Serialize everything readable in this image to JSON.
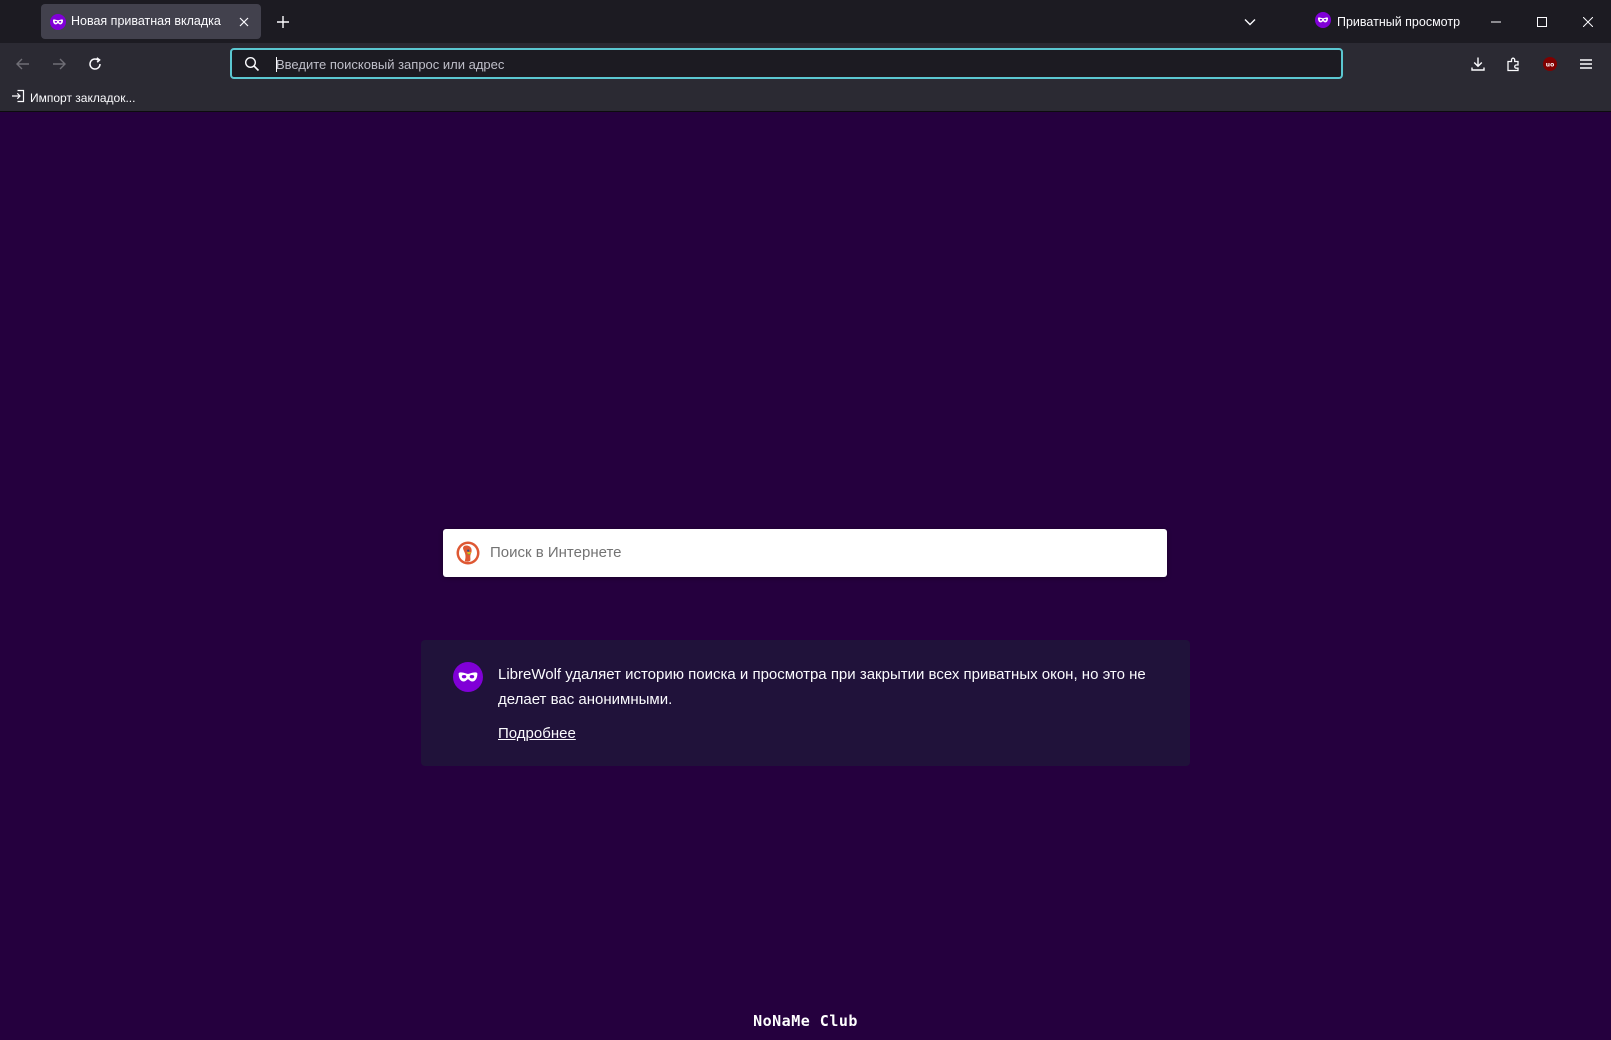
{
  "window": {
    "tab": {
      "title": "Новая приватная вкладка"
    },
    "private_indicator": {
      "label": "Приватный просмотр"
    }
  },
  "navbar": {
    "urlbar": {
      "placeholder": "Введите поисковый запрос или адрес"
    },
    "ublock_badge": "uo"
  },
  "bookmarks": {
    "import_label": "Импорт закладок..."
  },
  "content": {
    "search": {
      "placeholder": "Поиск в Интернете"
    },
    "info": {
      "message": "LibreWolf удаляет историю поиска и просмотра при закрытии всех приватных окон, но это не делает вас анонимными.",
      "learn_more": "Подробнее"
    },
    "footer_logo": "NoNaMe Club"
  },
  "colors": {
    "page_bg": "#25003e",
    "card_bg": "#20123a",
    "urlbar_focus": "#5bc7d1",
    "tabstrip_bg": "#1c1b22",
    "toolbar_bg": "#2b2a33",
    "private_purple": "#8000d7"
  }
}
